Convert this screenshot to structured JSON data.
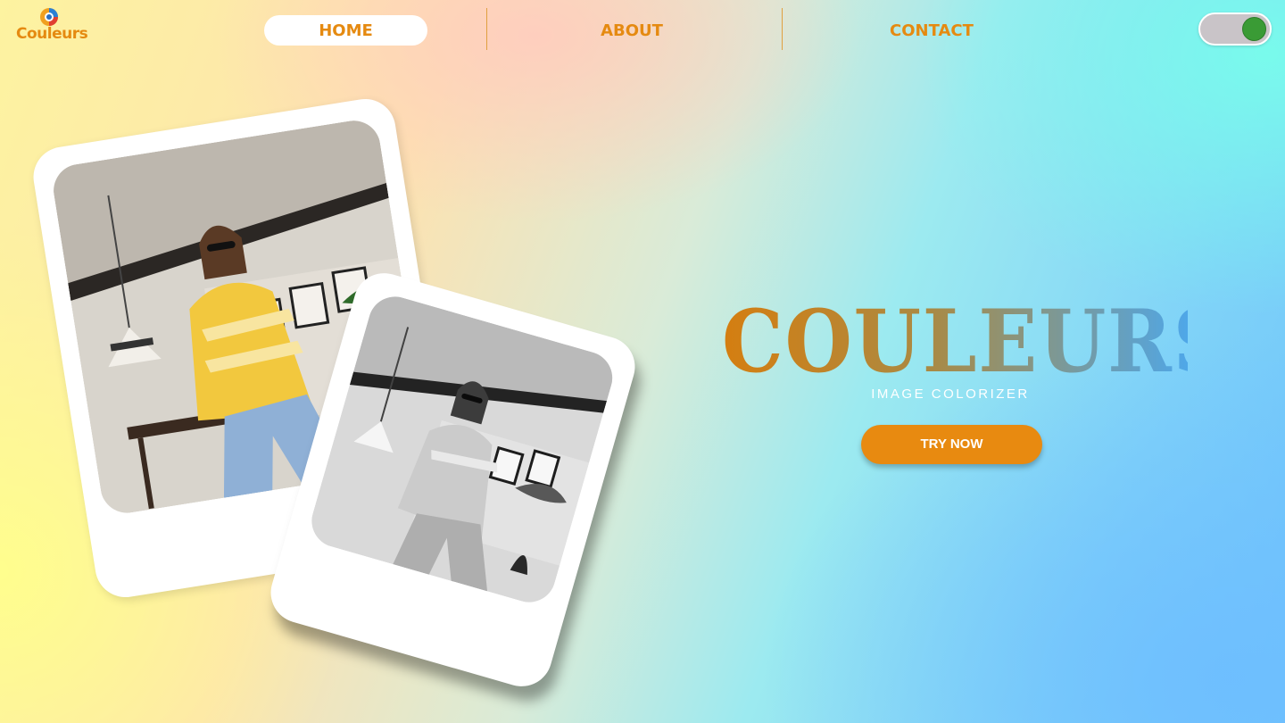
{
  "brand": {
    "logo_text": "Couleurs",
    "logo_icon": "colorful-swirl-logo-icon",
    "accent_color": "#e58a11"
  },
  "nav": {
    "items": [
      {
        "label": "HOME",
        "active": true
      },
      {
        "label": "ABOUT",
        "active": false
      },
      {
        "label": "CONTACT",
        "active": false
      }
    ]
  },
  "theme_toggle": {
    "state": "on",
    "knob_color": "#3a9b35"
  },
  "hero": {
    "title": "COULEURS",
    "subtitle": "IMAGE COLORIZER",
    "cta_label": "TRY NOW",
    "cta_color": "#e88a10"
  },
  "images": [
    {
      "name": "colored-photo",
      "style": "color"
    },
    {
      "name": "grayscale-photo",
      "style": "grayscale"
    }
  ]
}
